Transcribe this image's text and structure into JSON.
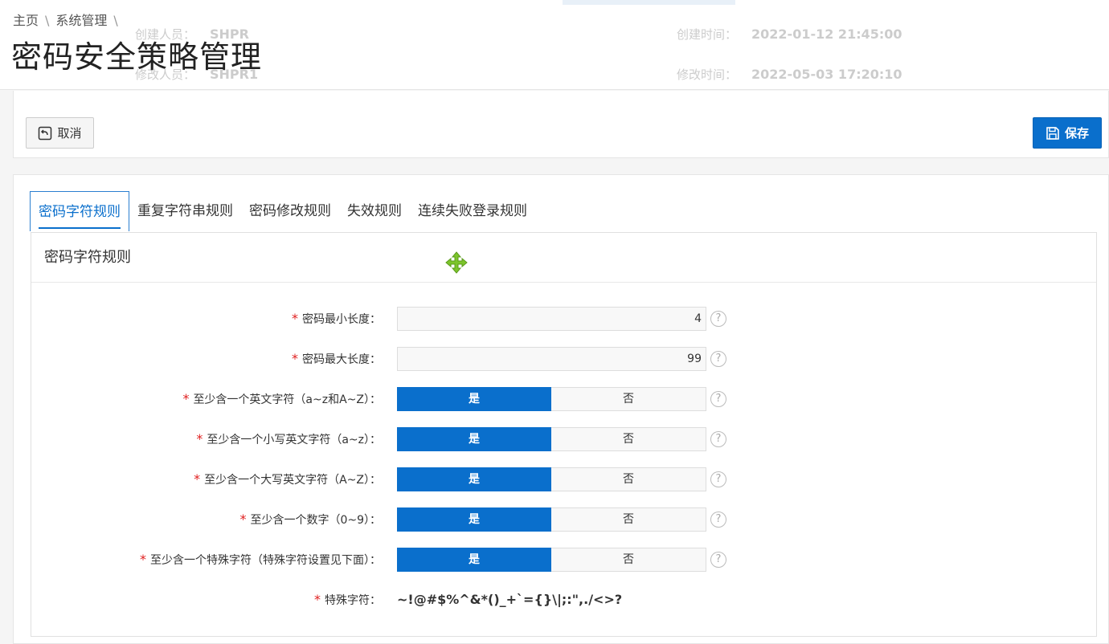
{
  "breadcrumb": [
    "主页",
    "系统管理"
  ],
  "breadcrumb_sep": "\\",
  "page_title": "密码安全策略管理",
  "meta": {
    "creator_label": "创建人员：",
    "creator_value": "SHPR",
    "modifier_label": "修改人员：",
    "modifier_value": "SHPR1",
    "ctime_label": "创建时间：",
    "ctime_value": "2022-01-12 21:45:00",
    "mtime_label": "修改时间：",
    "mtime_value": "2022-05-03 17:20:10"
  },
  "toolbar": {
    "cancel_label": "取消",
    "save_label": "保存"
  },
  "tabs": [
    "密码字符规则",
    "重复字符串规则",
    "密码修改规则",
    "失效规则",
    "连续失败登录规则"
  ],
  "panel_title": "密码字符规则",
  "form": {
    "min_length": {
      "label": "密码最小长度：",
      "value": "4"
    },
    "max_length": {
      "label": "密码最大长度：",
      "value": "99"
    },
    "toggle_yes": "是",
    "toggle_no": "否",
    "toggles": [
      {
        "label": "至少含一个英文字符（a~z和A~Z）：",
        "selected": "是"
      },
      {
        "label": "至少含一个小写英文字符（a~z）：",
        "selected": "是"
      },
      {
        "label": "至少含一个大写英文字符（A~Z）：",
        "selected": "是"
      },
      {
        "label": "至少含一个数字（0~9）：",
        "selected": "是"
      },
      {
        "label": "至少含一个特殊字符（特殊字符设置见下面）：",
        "selected": "是"
      }
    ],
    "special_chars": {
      "label": "特殊字符：",
      "value": "~!@#$%^&*()_+`={}\\|;:\",./<>?"
    },
    "required_mark": "*",
    "help_mark": "?"
  },
  "colors": {
    "primary": "#0a6fcc",
    "required": "#e02020",
    "move_icon": "#7cc52b"
  }
}
